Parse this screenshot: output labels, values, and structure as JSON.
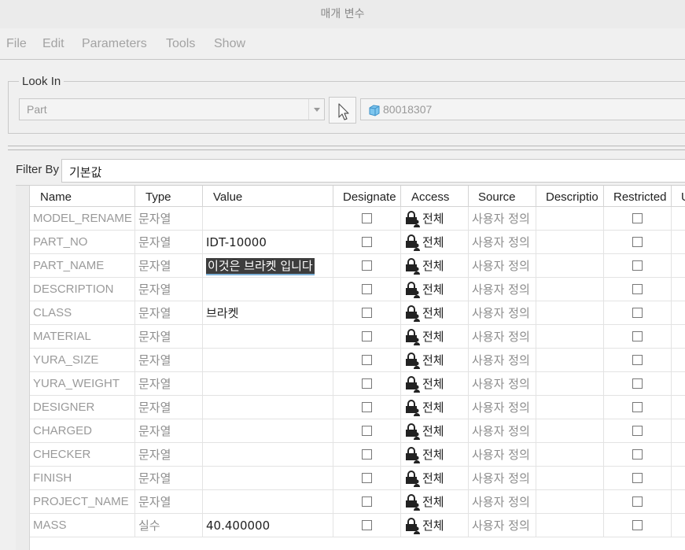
{
  "window": {
    "title": "매개 변수"
  },
  "menu": [
    "File",
    "Edit",
    "Parameters",
    "Tools",
    "Show"
  ],
  "look_in": {
    "legend": "Look In",
    "type_value": "Part",
    "model_name": "80018307"
  },
  "filter": {
    "label": "Filter By",
    "value": "기본값"
  },
  "table": {
    "columns": [
      "Name",
      "Type",
      "Value",
      "Designate",
      "Access",
      "Source",
      "Descriptio",
      "Restricted",
      "U"
    ],
    "rows": [
      {
        "name": "MODEL_RENAME",
        "type": "문자열",
        "value": "",
        "access": "전체",
        "source": "사용자 정의",
        "designated": false,
        "restricted": false
      },
      {
        "name": "PART_NO",
        "type": "문자열",
        "value": "IDT-10000",
        "access": "전체",
        "source": "사용자 정의",
        "designated": false,
        "restricted": false
      },
      {
        "name": "PART_NAME",
        "type": "문자열",
        "value": "이것은 브라켓 입니다",
        "access": "전체",
        "source": "사용자 정의",
        "designated": false,
        "restricted": false
      },
      {
        "name": "DESCRIPTION",
        "type": "문자열",
        "value": "",
        "access": "전체",
        "source": "사용자 정의",
        "designated": false,
        "restricted": false
      },
      {
        "name": "CLASS",
        "type": "문자열",
        "value": "브라켓",
        "access": "전체",
        "source": "사용자 정의",
        "designated": false,
        "restricted": false
      },
      {
        "name": "MATERIAL",
        "type": "문자열",
        "value": "",
        "access": "전체",
        "source": "사용자 정의",
        "designated": false,
        "restricted": false
      },
      {
        "name": "YURA_SIZE",
        "type": "문자열",
        "value": "",
        "access": "전체",
        "source": "사용자 정의",
        "designated": false,
        "restricted": false
      },
      {
        "name": "YURA_WEIGHT",
        "type": "문자열",
        "value": "",
        "access": "전체",
        "source": "사용자 정의",
        "designated": false,
        "restricted": false
      },
      {
        "name": "DESIGNER",
        "type": "문자열",
        "value": "",
        "access": "전체",
        "source": "사용자 정의",
        "designated": false,
        "restricted": false
      },
      {
        "name": "CHARGED",
        "type": "문자열",
        "value": "",
        "access": "전체",
        "source": "사용자 정의",
        "designated": false,
        "restricted": false
      },
      {
        "name": "CHECKER",
        "type": "문자열",
        "value": "",
        "access": "전체",
        "source": "사용자 정의",
        "designated": false,
        "restricted": false
      },
      {
        "name": "FINISH",
        "type": "문자열",
        "value": "",
        "access": "전체",
        "source": "사용자 정의",
        "designated": false,
        "restricted": false
      },
      {
        "name": "PROJECT_NAME",
        "type": "문자열",
        "value": "",
        "access": "전체",
        "source": "사용자 정의",
        "designated": false,
        "restricted": false
      },
      {
        "name": "MASS",
        "type": "실수",
        "value": "40.400000",
        "access": "전체",
        "source": "사용자 정의",
        "designated": false,
        "restricted": false
      }
    ]
  }
}
